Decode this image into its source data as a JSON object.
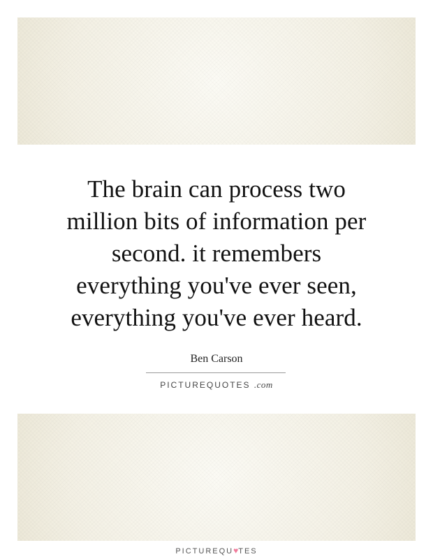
{
  "quote": {
    "lines": [
      "The brain can process two",
      "million bits of information per",
      "second. it remembers",
      "everything you've ever seen,",
      "everything you've ever heard."
    ]
  },
  "author": "Ben Carson",
  "watermark": {
    "brand": "PICTUREQUOTES",
    "suffix": ".com"
  },
  "footer": {
    "brand_start": "PICTUREQU",
    "heart_glyph": "♥",
    "brand_end": "TES"
  },
  "colors": {
    "panel": "#f4f1e6",
    "text": "#111111",
    "heart": "#f07a9a"
  }
}
